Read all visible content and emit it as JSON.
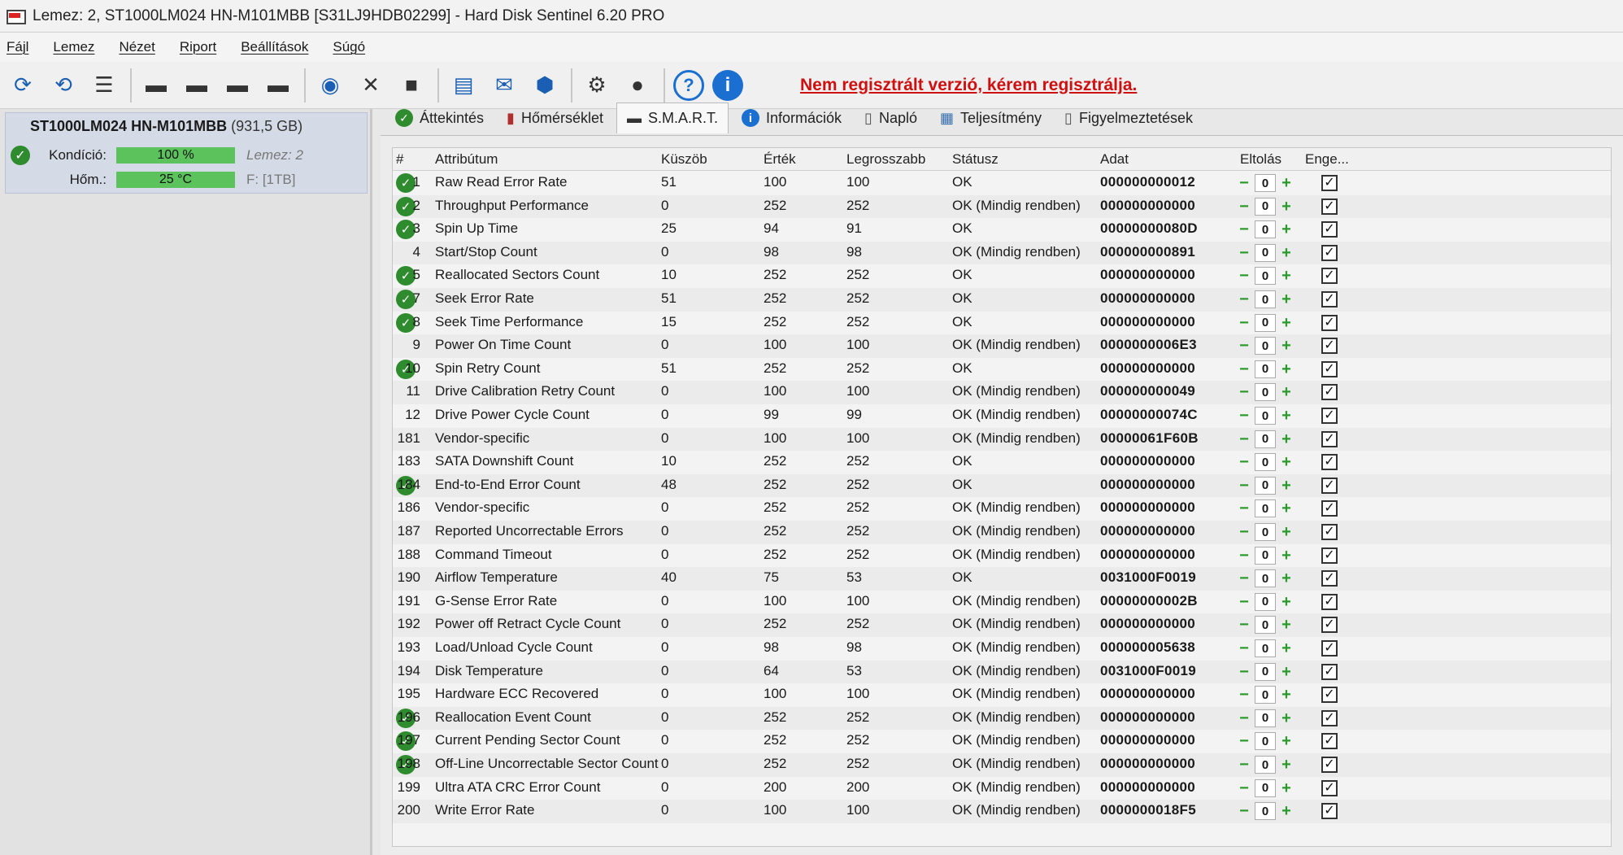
{
  "window": {
    "title": "Lemez: 2, ST1000LM024 HN-M101MBB [S31LJ9HDB02299]  -  Hard Disk Sentinel 6.20 PRO"
  },
  "menu": [
    "Fájl",
    "Lemez",
    "Nézet",
    "Riport",
    "Beállítások",
    "Súgó"
  ],
  "toolbar": {
    "unregistered_text": "Nem regisztrált verzió, kérem regisztrálja."
  },
  "disk": {
    "name": "ST1000LM024 HN-M101MBB",
    "size": "(931,5 GB)",
    "condition_label": "Kondíció:",
    "condition_value": "100 %",
    "condition_percent": 100,
    "condition_extra": "Lemez: 2",
    "temp_label": "Hőm.:",
    "temp_value": "25 °C",
    "temp_extra": "F: [1TB]"
  },
  "tabs": [
    "Áttekintés",
    "Hőmérséklet",
    "S.M.A.R.T.",
    "Információk",
    "Napló",
    "Teljesítmény",
    "Figyelmeztetések"
  ],
  "columns": {
    "hash": "#",
    "attribute": "Attribútum",
    "threshold": "Küszöb",
    "value": "Érték",
    "worst": "Legrosszabb",
    "status": "Státusz",
    "data": "Adat",
    "offset": "Eltolás",
    "enable": "Enge..."
  },
  "rows": [
    {
      "id": "1",
      "name": "Raw Read Error Rate",
      "threshold": "51",
      "value": "100",
      "worst": "100",
      "status": "OK",
      "data": "000000000012",
      "ok": true,
      "offset": "0"
    },
    {
      "id": "2",
      "name": "Throughput Performance",
      "threshold": "0",
      "value": "252",
      "worst": "252",
      "status": "OK (Mindig rendben)",
      "data": "000000000000",
      "ok": true,
      "offset": "0"
    },
    {
      "id": "3",
      "name": "Spin Up Time",
      "threshold": "25",
      "value": "94",
      "worst": "91",
      "status": "OK",
      "data": "00000000080D",
      "ok": true,
      "offset": "0"
    },
    {
      "id": "4",
      "name": "Start/Stop Count",
      "threshold": "0",
      "value": "98",
      "worst": "98",
      "status": "OK (Mindig rendben)",
      "data": "000000000891",
      "ok": false,
      "offset": "0"
    },
    {
      "id": "5",
      "name": "Reallocated Sectors Count",
      "threshold": "10",
      "value": "252",
      "worst": "252",
      "status": "OK",
      "data": "000000000000",
      "ok": true,
      "offset": "0"
    },
    {
      "id": "7",
      "name": "Seek Error Rate",
      "threshold": "51",
      "value": "252",
      "worst": "252",
      "status": "OK",
      "data": "000000000000",
      "ok": true,
      "offset": "0"
    },
    {
      "id": "8",
      "name": "Seek Time Performance",
      "threshold": "15",
      "value": "252",
      "worst": "252",
      "status": "OK",
      "data": "000000000000",
      "ok": true,
      "offset": "0"
    },
    {
      "id": "9",
      "name": "Power On Time Count",
      "threshold": "0",
      "value": "100",
      "worst": "100",
      "status": "OK (Mindig rendben)",
      "data": "0000000006E3",
      "ok": false,
      "offset": "0"
    },
    {
      "id": "10",
      "name": "Spin Retry Count",
      "threshold": "51",
      "value": "252",
      "worst": "252",
      "status": "OK",
      "data": "000000000000",
      "ok": true,
      "offset": "0"
    },
    {
      "id": "11",
      "name": "Drive Calibration Retry Count",
      "threshold": "0",
      "value": "100",
      "worst": "100",
      "status": "OK (Mindig rendben)",
      "data": "000000000049",
      "ok": false,
      "offset": "0"
    },
    {
      "id": "12",
      "name": "Drive Power Cycle Count",
      "threshold": "0",
      "value": "99",
      "worst": "99",
      "status": "OK (Mindig rendben)",
      "data": "00000000074C",
      "ok": false,
      "offset": "0"
    },
    {
      "id": "181",
      "name": "Vendor-specific",
      "threshold": "0",
      "value": "100",
      "worst": "100",
      "status": "OK (Mindig rendben)",
      "data": "00000061F60B",
      "ok": false,
      "offset": "0"
    },
    {
      "id": "183",
      "name": "SATA Downshift Count",
      "threshold": "10",
      "value": "252",
      "worst": "252",
      "status": "OK",
      "data": "000000000000",
      "ok": false,
      "offset": "0"
    },
    {
      "id": "184",
      "name": "End-to-End Error Count",
      "threshold": "48",
      "value": "252",
      "worst": "252",
      "status": "OK",
      "data": "000000000000",
      "ok": true,
      "offset": "0"
    },
    {
      "id": "186",
      "name": "Vendor-specific",
      "threshold": "0",
      "value": "252",
      "worst": "252",
      "status": "OK (Mindig rendben)",
      "data": "000000000000",
      "ok": false,
      "offset": "0"
    },
    {
      "id": "187",
      "name": "Reported Uncorrectable Errors",
      "threshold": "0",
      "value": "252",
      "worst": "252",
      "status": "OK (Mindig rendben)",
      "data": "000000000000",
      "ok": false,
      "offset": "0"
    },
    {
      "id": "188",
      "name": "Command Timeout",
      "threshold": "0",
      "value": "252",
      "worst": "252",
      "status": "OK (Mindig rendben)",
      "data": "000000000000",
      "ok": false,
      "offset": "0"
    },
    {
      "id": "190",
      "name": "Airflow Temperature",
      "threshold": "40",
      "value": "75",
      "worst": "53",
      "status": "OK",
      "data": "0031000F0019",
      "ok": false,
      "offset": "0"
    },
    {
      "id": "191",
      "name": "G-Sense Error Rate",
      "threshold": "0",
      "value": "100",
      "worst": "100",
      "status": "OK (Mindig rendben)",
      "data": "00000000002B",
      "ok": false,
      "offset": "0"
    },
    {
      "id": "192",
      "name": "Power off Retract Cycle Count",
      "threshold": "0",
      "value": "252",
      "worst": "252",
      "status": "OK (Mindig rendben)",
      "data": "000000000000",
      "ok": false,
      "offset": "0"
    },
    {
      "id": "193",
      "name": "Load/Unload Cycle Count",
      "threshold": "0",
      "value": "98",
      "worst": "98",
      "status": "OK (Mindig rendben)",
      "data": "000000005638",
      "ok": false,
      "offset": "0"
    },
    {
      "id": "194",
      "name": "Disk Temperature",
      "threshold": "0",
      "value": "64",
      "worst": "53",
      "status": "OK (Mindig rendben)",
      "data": "0031000F0019",
      "ok": false,
      "offset": "0"
    },
    {
      "id": "195",
      "name": "Hardware ECC Recovered",
      "threshold": "0",
      "value": "100",
      "worst": "100",
      "status": "OK (Mindig rendben)",
      "data": "000000000000",
      "ok": false,
      "offset": "0"
    },
    {
      "id": "196",
      "name": "Reallocation Event Count",
      "threshold": "0",
      "value": "252",
      "worst": "252",
      "status": "OK (Mindig rendben)",
      "data": "000000000000",
      "ok": true,
      "offset": "0"
    },
    {
      "id": "197",
      "name": "Current Pending Sector Count",
      "threshold": "0",
      "value": "252",
      "worst": "252",
      "status": "OK (Mindig rendben)",
      "data": "000000000000",
      "ok": true,
      "offset": "0"
    },
    {
      "id": "198",
      "name": "Off-Line Uncorrectable Sector Count",
      "threshold": "0",
      "value": "252",
      "worst": "252",
      "status": "OK (Mindig rendben)",
      "data": "000000000000",
      "ok": true,
      "offset": "0"
    },
    {
      "id": "199",
      "name": "Ultra ATA CRC Error Count",
      "threshold": "0",
      "value": "200",
      "worst": "200",
      "status": "OK (Mindig rendben)",
      "data": "000000000000",
      "ok": false,
      "offset": "0"
    },
    {
      "id": "200",
      "name": "Write Error Rate",
      "threshold": "0",
      "value": "100",
      "worst": "100",
      "status": "OK (Mindig rendben)",
      "data": "0000000018F5",
      "ok": false,
      "offset": "0"
    }
  ]
}
